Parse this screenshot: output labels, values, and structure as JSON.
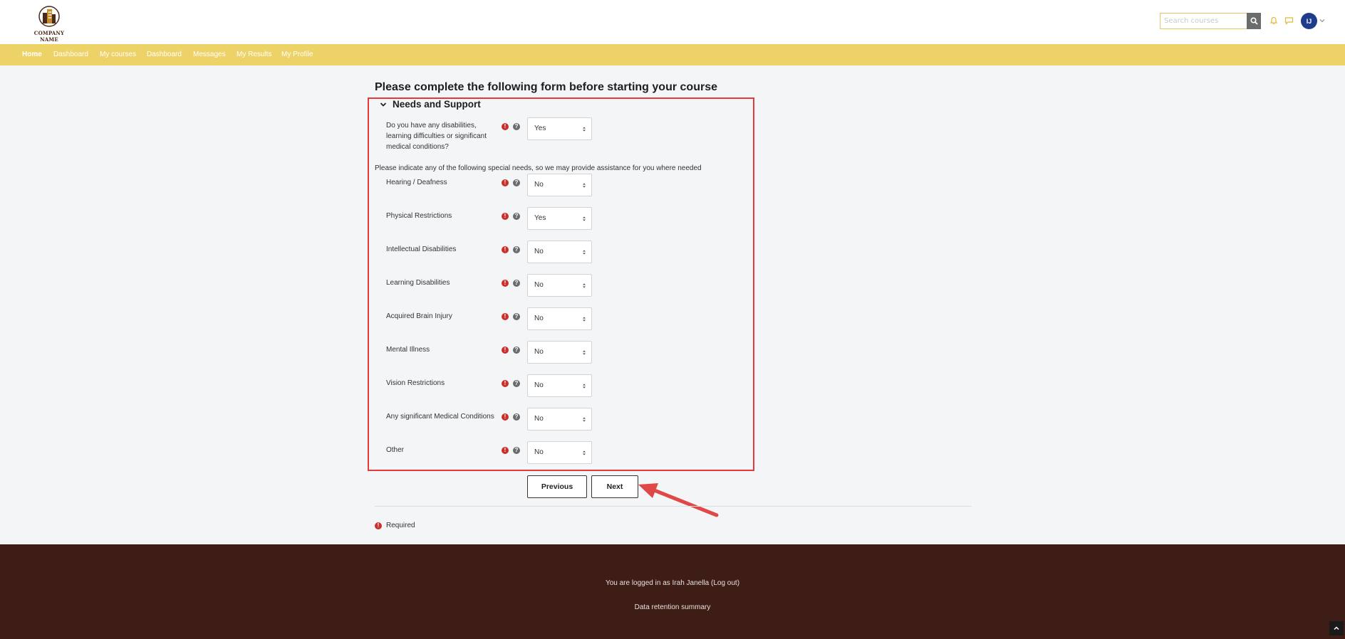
{
  "header": {
    "logo_text": "COMPANY NAME",
    "search_placeholder": "Search courses",
    "user_initials": "IJ",
    "icons": [
      "search-icon",
      "bell-icon",
      "chat-icon",
      "chevron-down-icon"
    ],
    "accent_color": "#edd267"
  },
  "nav": {
    "items": [
      "Home",
      "Dashboard",
      "My courses",
      "Dashboard",
      "Messages",
      "My Results",
      "My Profile"
    ],
    "active": "Home"
  },
  "form": {
    "title": "Please complete the following form before starting your course",
    "section_title": "Needs and Support",
    "main_question": {
      "label": "Do you have any disabilities, learning difficulties or significant medical conditions?",
      "value": "Yes"
    },
    "hint": "Please indicate any of the following special needs, so we may provide assistance for you where needed",
    "questions": [
      {
        "label": "Hearing / Deafness",
        "value": "No"
      },
      {
        "label": "Physical Restrictions",
        "value": "Yes"
      },
      {
        "label": "Intellectual Disabilities",
        "value": "No"
      },
      {
        "label": "Learning Disabilities",
        "value": "No"
      },
      {
        "label": "Acquired Brain Injury",
        "value": "No"
      },
      {
        "label": "Mental Illness",
        "value": "No"
      },
      {
        "label": "Vision Restrictions",
        "value": "No"
      },
      {
        "label": "Any significant Medical Conditions",
        "value": "No"
      },
      {
        "label": "Other",
        "value": "No"
      }
    ],
    "buttons": {
      "previous": "Previous",
      "next": "Next"
    },
    "required_legend": "Required",
    "highlight_color": "#e23a3a"
  },
  "footer": {
    "login_text": "You are logged in as Irah Janella (Log out)",
    "retention_link": "Data retention summary",
    "background": "#3e1d17"
  }
}
